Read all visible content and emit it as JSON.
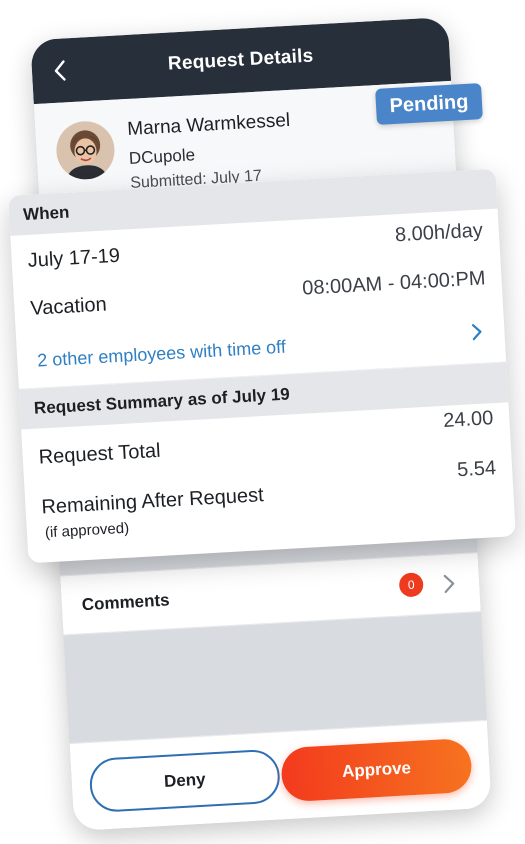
{
  "header": {
    "title": "Request Details"
  },
  "employee": {
    "name": "Marna Warmkessel",
    "company": "DCupole",
    "submitted": "Submitted: July 17"
  },
  "status": {
    "label": "Pending",
    "color": "#4a84c9"
  },
  "when": {
    "heading": "When",
    "dates": "July 17-19",
    "hours_per_day": "8.00h/day",
    "type": "Vacation",
    "time_range": "08:00AM - 04:00:PM",
    "others_link": "2 other employees with time off"
  },
  "summary": {
    "heading": "Request Summary as of July 19",
    "total_label": "Request Total",
    "total_value": "24.00",
    "remaining_label": "Remaining After Request",
    "remaining_sub": "(if approved)",
    "remaining_value": "5.54"
  },
  "comments": {
    "label": "Comments",
    "count": "0"
  },
  "actions": {
    "deny": "Deny",
    "approve": "Approve"
  },
  "colors": {
    "header_bg": "#27303a",
    "accent_blue": "#2e6fb3",
    "approve_orange": "#f33a1e"
  },
  "icons": [
    "back-chevron-icon",
    "chevron-right-icon",
    "avatar-photo"
  ]
}
